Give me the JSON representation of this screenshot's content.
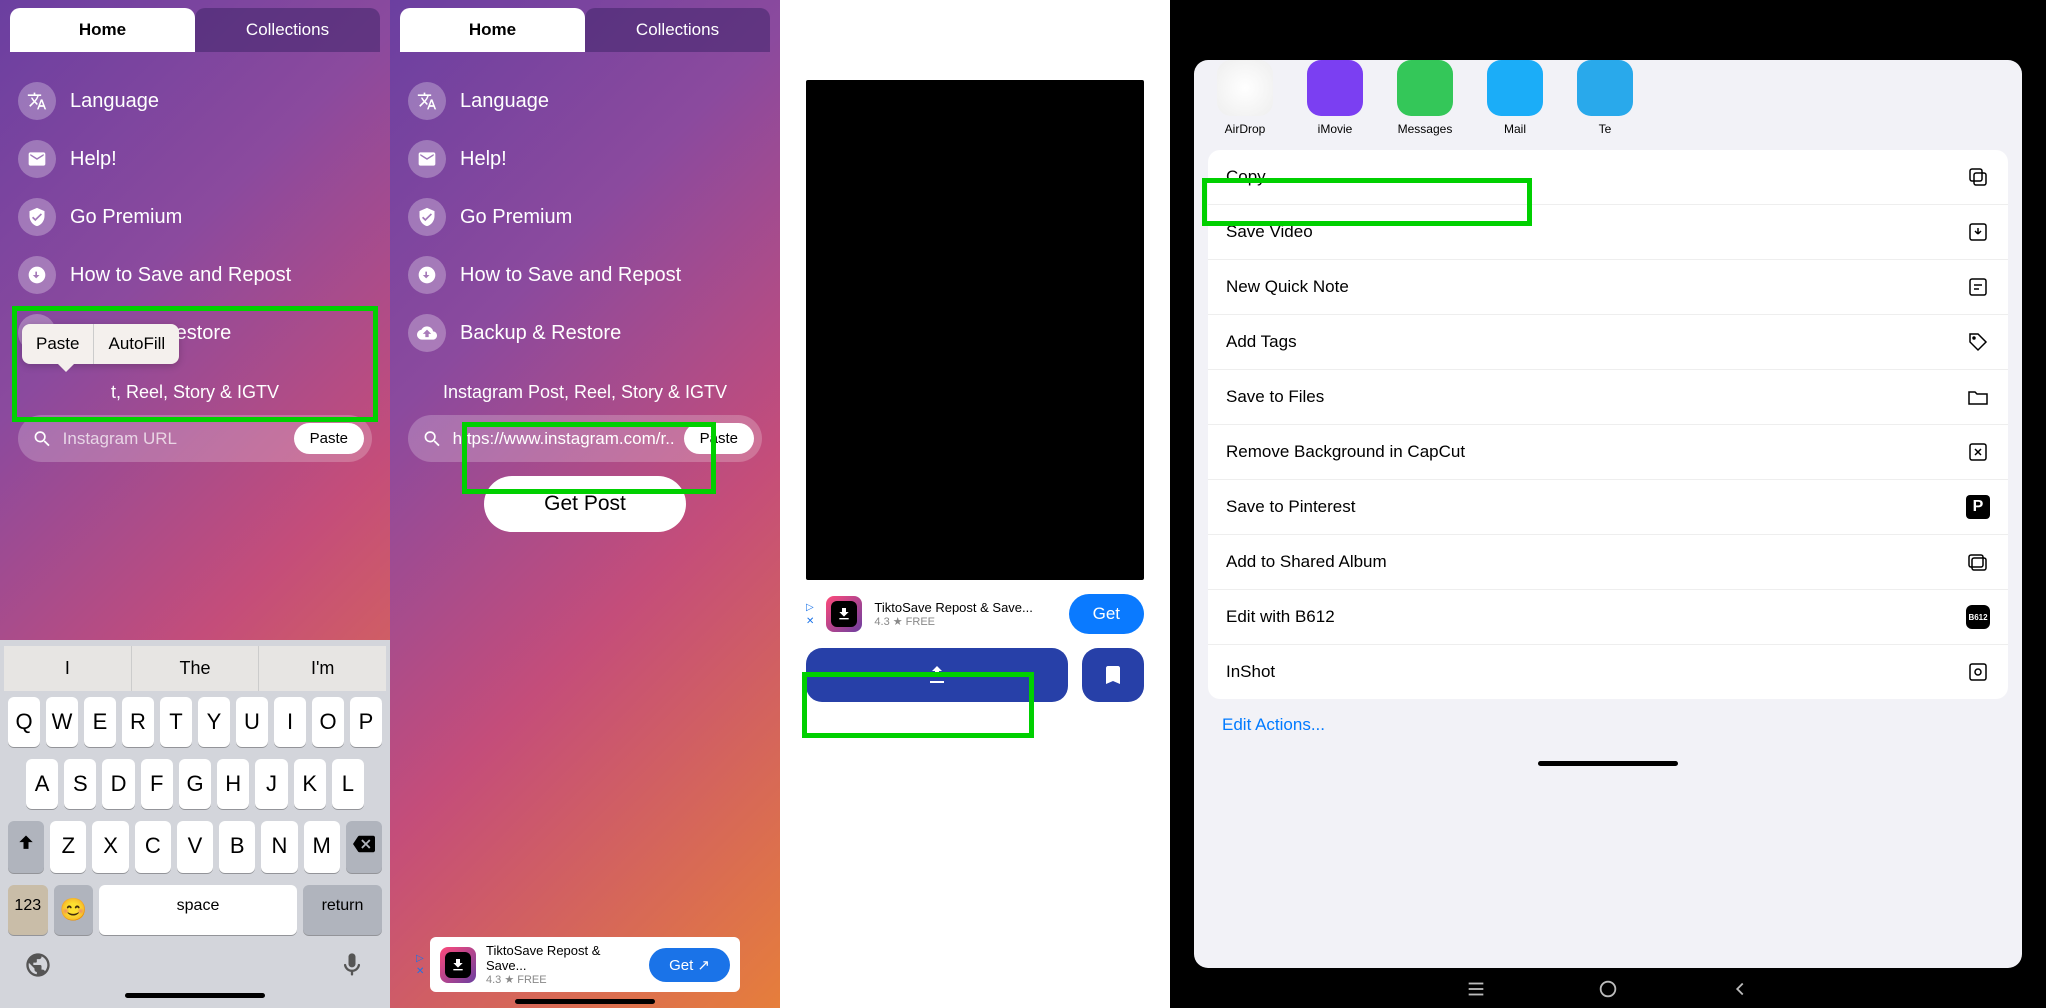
{
  "screen1": {
    "tabs": {
      "home": "Home",
      "collections": "Collections"
    },
    "menu": {
      "language": "Language",
      "help": "Help!",
      "premium": "Go Premium",
      "howto": "How to Save and Repost",
      "backup": "Backup & Restore"
    },
    "hint": "t, Reel, Story & IGTV",
    "search": {
      "placeholder": "Instagram URL",
      "paste": "Paste"
    },
    "ctx": {
      "paste": "Paste",
      "autofill": "AutoFill"
    },
    "kb": {
      "sug1": "I",
      "sug2": "The",
      "sug3": "I'm",
      "r1": [
        "Q",
        "W",
        "E",
        "R",
        "T",
        "Y",
        "U",
        "I",
        "O",
        "P"
      ],
      "r2": [
        "A",
        "S",
        "D",
        "F",
        "G",
        "H",
        "J",
        "K",
        "L"
      ],
      "r3": [
        "Z",
        "X",
        "C",
        "V",
        "B",
        "N",
        "M"
      ],
      "num": "123",
      "space": "space",
      "ret": "return"
    }
  },
  "screen2": {
    "tabs": {
      "home": "Home",
      "collections": "Collections"
    },
    "menu": {
      "language": "Language",
      "help": "Help!",
      "premium": "Go Premium",
      "howto": "How to Save and Repost",
      "backup": "Backup & Restore"
    },
    "hint": "Instagram Post, Reel, Story & IGTV",
    "search": {
      "value": "https://www.instagram.com/r...",
      "paste": "Paste"
    },
    "getpost": "Get Post",
    "ad": {
      "title": "TiktoSave Repost & Save...",
      "sub": "4.3 ★ FREE",
      "btn": "Get ↗"
    }
  },
  "screen3": {
    "ad": {
      "title": "TiktoSave Repost & Save...",
      "sub": "4.3 ★ FREE",
      "btn": "Get"
    }
  },
  "screen4": {
    "apps": {
      "airdrop": "AirDrop",
      "imovie": "iMovie",
      "messages": "Messages",
      "mail": "Mail",
      "te": "Te"
    },
    "actions": {
      "copy": "Copy",
      "savevideo": "Save Video",
      "quicknote": "New Quick Note",
      "addtags": "Add Tags",
      "savetofiles": "Save to Files",
      "capcut": "Remove Background in CapCut",
      "pinterest": "Save to Pinterest",
      "sharedalbum": "Add to Shared Album",
      "b612": "Edit with B612",
      "inshot": "InShot"
    },
    "editactions": "Edit Actions..."
  }
}
